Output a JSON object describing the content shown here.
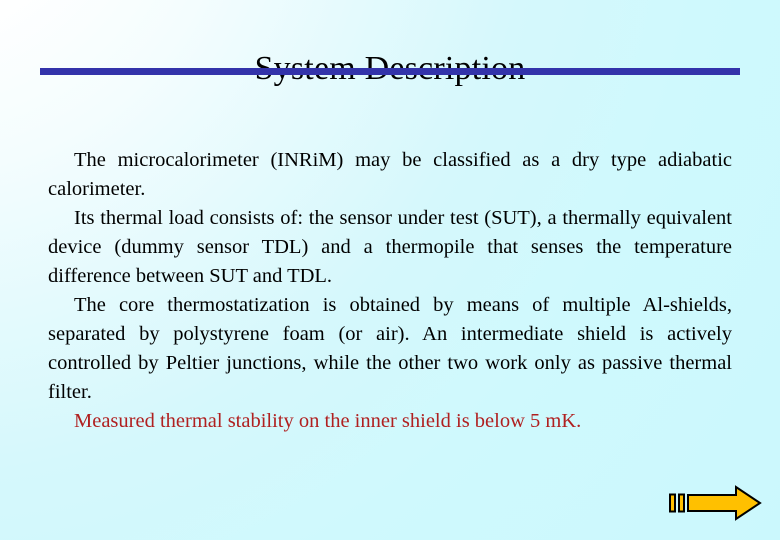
{
  "slide": {
    "title": "System Description",
    "accent_rule_color": "#3333AA",
    "background_from": "#FFFFFF",
    "background_to": "#CBF8FD",
    "body_text_color": "#000000",
    "highlight_text_color": "#B02020",
    "paragraphs": [
      {
        "id": "para-classification",
        "indented": true,
        "highlight": false,
        "text": "The microcalorimeter (INRiM) may be classified as a dry type adiabatic calorimeter."
      },
      {
        "id": "para-thermal-load",
        "indented": true,
        "highlight": false,
        "text": "Its thermal load consists of: the sensor under test (SUT), a thermally equivalent device (dummy sensor TDL) and a thermopile that senses the temperature difference between  SUT and TDL."
      },
      {
        "id": "para-thermostatization",
        "indented": true,
        "highlight": false,
        "text": "The core thermostatization is  obtained by means of  multiple Al-shields, separated by polystyrene foam (or air). An intermediate shield is actively controlled by Peltier junctions, while the other two work only as passive thermal filter."
      },
      {
        "id": "para-stability",
        "indented": true,
        "highlight": true,
        "text": "Measured thermal stability on the inner shield is below 5 mK."
      }
    ]
  },
  "navigation": {
    "next_arrow_label": "next-slide-arrow",
    "arrow_fill": "#FFC000",
    "arrow_stroke": "#000000"
  }
}
